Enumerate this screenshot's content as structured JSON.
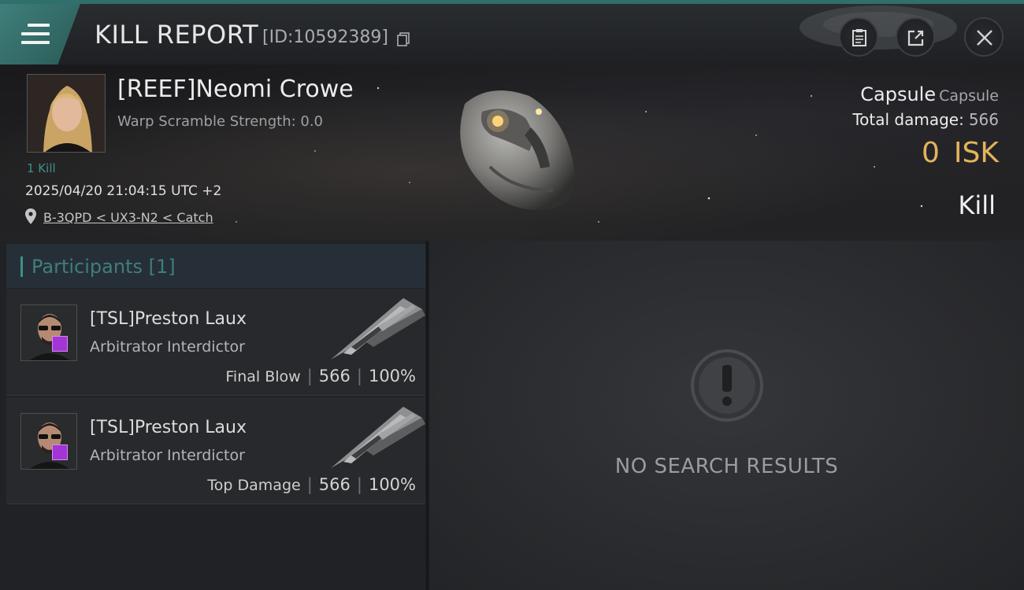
{
  "header": {
    "title": "KILL REPORT",
    "report_id": "[ID:10592389]",
    "icons": [
      "menu-icon",
      "copy-icon",
      "clipboard-icon",
      "share-icon",
      "close-icon"
    ]
  },
  "victim": {
    "name": "[REEF]Neomi Crowe",
    "warp_scramble": "Warp Scramble Strength: 0.0",
    "kills": "1 Kill",
    "datetime": "2025/04/20 21:04:15 UTC +2",
    "location": "B-3QPD < UX3-N2 < Catch",
    "ship_class": "Capsule",
    "ship_name": "Capsule",
    "total_damage_label": "Total damage:",
    "total_damage_value": "566",
    "isk_value": "0",
    "isk_unit": "ISK",
    "result": "Kill"
  },
  "participants": {
    "label": "Participants [1]",
    "items": [
      {
        "name": "[TSL]Preston Laux",
        "ship": "Arbitrator Interdictor",
        "role": "Final Blow",
        "damage": "566",
        "percent": "100%"
      },
      {
        "name": "[TSL]Preston Laux",
        "ship": "Arbitrator Interdictor",
        "role": "Top Damage",
        "damage": "566",
        "percent": "100%"
      }
    ]
  },
  "results": {
    "empty_text": "NO SEARCH RESULTS"
  },
  "colors": {
    "accent": "#3f8f88",
    "isk": "#e3b45a",
    "badge": "#a334d6"
  }
}
